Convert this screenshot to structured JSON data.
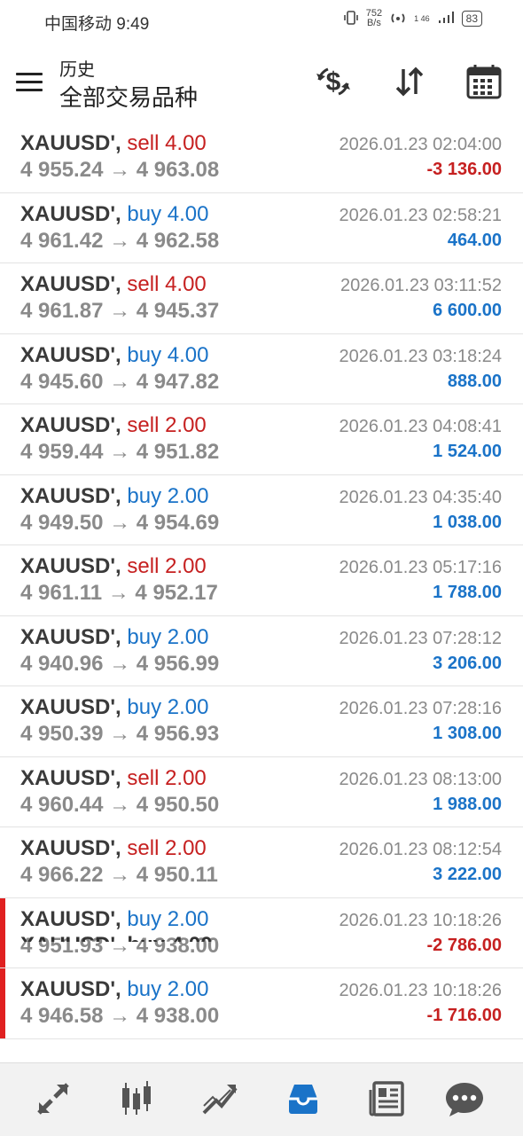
{
  "status_bar": {
    "carrier_time": "中国移动 9:49",
    "speed_value": "752",
    "speed_unit": "B/s",
    "network": "1 46",
    "battery": "83"
  },
  "header": {
    "title": "历史",
    "subtitle": "全部交易品种",
    "icons": [
      "menu-icon",
      "currency-exchange-icon",
      "sort-icon",
      "calendar-icon"
    ]
  },
  "trades": [
    {
      "symbol": "XAUUSD',",
      "type": "sell 4.00",
      "prices": "4 955.24 → 4 963.08",
      "time": "2026.01.23 02:04:00",
      "profit": "-3 136.00",
      "flag": false
    },
    {
      "symbol": "XAUUSD',",
      "type": "buy 4.00",
      "prices": "4 961.42 → 4 962.58",
      "time": "2026.01.23 02:58:21",
      "profit": "464.00",
      "flag": false
    },
    {
      "symbol": "XAUUSD',",
      "type": "sell 4.00",
      "prices": "4 961.87 → 4 945.37",
      "time": "2026.01.23 03:11:52",
      "profit": "6 600.00",
      "flag": false
    },
    {
      "symbol": "XAUUSD',",
      "type": "buy 4.00",
      "prices": "4 945.60 → 4 947.82",
      "time": "2026.01.23 03:18:24",
      "profit": "888.00",
      "flag": false
    },
    {
      "symbol": "XAUUSD',",
      "type": "sell 2.00",
      "prices": "4 959.44 → 4 951.82",
      "time": "2026.01.23 04:08:41",
      "profit": "1 524.00",
      "flag": false
    },
    {
      "symbol": "XAUUSD',",
      "type": "buy 2.00",
      "prices": "4 949.50 → 4 954.69",
      "time": "2026.01.23 04:35:40",
      "profit": "1 038.00",
      "flag": false
    },
    {
      "symbol": "XAUUSD',",
      "type": "sell 2.00",
      "prices": "4 961.11 → 4 952.17",
      "time": "2026.01.23 05:17:16",
      "profit": "1 788.00",
      "flag": false
    },
    {
      "symbol": "XAUUSD',",
      "type": "buy 2.00",
      "prices": "4 940.96 → 4 956.99",
      "time": "2026.01.23 07:28:12",
      "profit": "3 206.00",
      "flag": false
    },
    {
      "symbol": "XAUUSD',",
      "type": "buy 2.00",
      "prices": "4 950.39 → 4 956.93",
      "time": "2026.01.23 07:28:16",
      "profit": "1 308.00",
      "flag": false
    },
    {
      "symbol": "XAUUSD',",
      "type": "sell 2.00",
      "prices": "4 960.44 → 4 950.50",
      "time": "2026.01.23 08:13:00",
      "profit": "1 988.00",
      "flag": false
    },
    {
      "symbol": "XAUUSD',",
      "type": "sell 2.00",
      "prices": "4 966.22 → 4 950.11",
      "time": "2026.01.23 08:12:54",
      "profit": "3 222.00",
      "flag": false
    },
    {
      "symbol": "XAUUSD',",
      "type": "buy 2.00",
      "prices": "4 951.93 → 4 938.00",
      "time": "2026.01.23 10:18:26",
      "profit": "-2 786.00",
      "flag": true
    },
    {
      "symbol": "XAUUSD',",
      "type": "buy 2.00",
      "prices": "4 946.58 → 4 938.00",
      "time": "2026.01.23 10:18:26",
      "profit": "-1 716.00",
      "flag": true
    }
  ],
  "partial_row": "XAUUSD', buy 4.00",
  "bottom_nav": [
    "quotes-icon",
    "chart-icon",
    "trade-icon",
    "history-icon",
    "news-icon",
    "chat-icon"
  ],
  "colors": {
    "sell": "#c62020",
    "buy": "#1a73c8",
    "active": "#1a73c8",
    "nav_icon": "#555555"
  }
}
